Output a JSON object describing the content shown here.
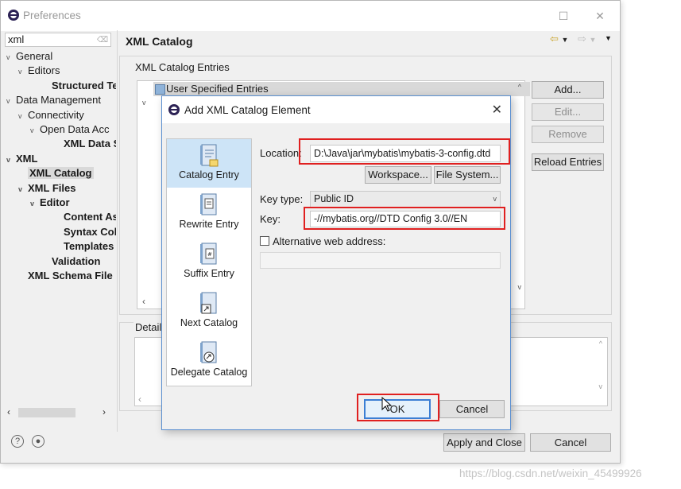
{
  "window": {
    "title": "Preferences",
    "maximize_icon": "☐",
    "close_icon": "✕"
  },
  "nav": {
    "filter_value": "xml",
    "tree": [
      {
        "label": "General",
        "depth": 0,
        "twisty": "v",
        "bold": false
      },
      {
        "label": "Editors",
        "depth": 1,
        "twisty": "v",
        "bold": false
      },
      {
        "label": "Structured Te",
        "depth": 3,
        "twisty": "",
        "bold": true
      },
      {
        "label": "Data Management",
        "depth": 0,
        "twisty": "v",
        "bold": false
      },
      {
        "label": "Connectivity",
        "depth": 1,
        "twisty": "v",
        "bold": false
      },
      {
        "label": "Open Data Acc",
        "depth": 2,
        "twisty": "v",
        "bold": false
      },
      {
        "label": "XML Data S",
        "depth": 4,
        "twisty": "",
        "bold": true
      },
      {
        "label": "XML",
        "depth": 0,
        "twisty": "v",
        "bold": true
      },
      {
        "label": "XML Catalog",
        "depth": 1,
        "twisty": "",
        "bold": true,
        "selected": true
      },
      {
        "label": "XML Files",
        "depth": 1,
        "twisty": "v",
        "bold": true
      },
      {
        "label": "Editor",
        "depth": 2,
        "twisty": "v",
        "bold": true
      },
      {
        "label": "Content As",
        "depth": 4,
        "twisty": "",
        "bold": true
      },
      {
        "label": "Syntax Colc",
        "depth": 4,
        "twisty": "",
        "bold": true
      },
      {
        "label": "Templates",
        "depth": 4,
        "twisty": "",
        "bold": true
      },
      {
        "label": "Validation",
        "depth": 3,
        "twisty": "",
        "bold": true
      },
      {
        "label": "XML Schema File",
        "depth": 1,
        "twisty": "",
        "bold": true
      }
    ]
  },
  "page": {
    "title": "XML Catalog",
    "entries_group": "XML Catalog Entries",
    "tree_header": "User Specified Entries",
    "details_group": "Detail",
    "buttons": {
      "add": "Add...",
      "edit": "Edit...",
      "remove": "Remove",
      "reload": "Reload Entries"
    },
    "apply_close": "Apply and Close",
    "cancel": "Cancel"
  },
  "dialog": {
    "title": "Add XML Catalog Element",
    "types": [
      {
        "label": "Catalog Entry",
        "icon": "catalog-entry-icon",
        "selected": true
      },
      {
        "label": "Rewrite Entry",
        "icon": "rewrite-entry-icon"
      },
      {
        "label": "Suffix Entry",
        "icon": "suffix-entry-icon"
      },
      {
        "label": "Next Catalog",
        "icon": "next-catalog-icon"
      },
      {
        "label": "Delegate Catalog",
        "icon": "delegate-catalog-icon"
      }
    ],
    "location_label": "Location:",
    "location_value": "D:\\Java\\jar\\mybatis\\mybatis-3-config.dtd",
    "workspace_btn": "Workspace...",
    "filesystem_btn": "File System...",
    "keytype_label": "Key type:",
    "keytype_value": "Public ID",
    "key_label": "Key:",
    "key_value": "-//mybatis.org//DTD Config 3.0//EN",
    "alt_label": "Alternative web address:",
    "ok": "OK",
    "cancel": "Cancel"
  },
  "watermark": "https://blog.csdn.net/weixin_45499926",
  "colors": {
    "highlight": "#e02020",
    "accent": "#3c7fd4"
  }
}
